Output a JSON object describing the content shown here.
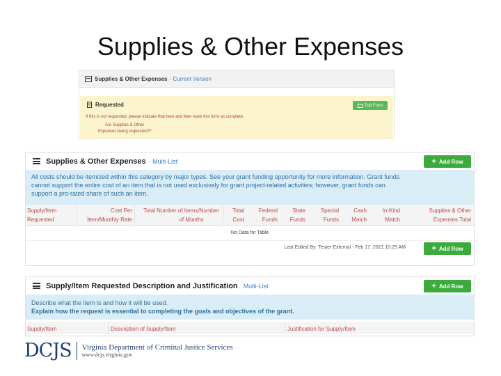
{
  "slide": {
    "title": "Supplies & Other Expenses"
  },
  "panel1": {
    "title": "Supplies & Other Expenses",
    "version": "- Current Version",
    "requested_label": "Requested",
    "edit_button": "Edit Form",
    "note": "If this is not requested, please indicate that here and then mark this form as complete.",
    "question_line1": "Are Supplies & Other",
    "question_line2": "Expenses being requested?*"
  },
  "panel2": {
    "title": "Supplies & Other Expenses",
    "subtitle": "- Multi-List",
    "add_row_top": "Add Row",
    "info_lines": [
      "All costs should be itemized within this category by major types. See your grant funding opportunity for more information. Grant funds",
      "cannot support the entire cost of an item that is not used exclusively for grant project-related activities; however, grant funds can",
      "support a pro-rated share of such an item."
    ],
    "columns": [
      {
        "l1": "Supply/Item",
        "l2": "Requested"
      },
      {
        "l1": "Cost Per",
        "l2": "Item/Monthly Rate"
      },
      {
        "l1": "Total Number of Items/Number",
        "l2": "of Months"
      },
      {
        "l1": "Total",
        "l2": "Cost"
      },
      {
        "l1": "Federal",
        "l2": "Funds"
      },
      {
        "l1": "State",
        "l2": "Funds"
      },
      {
        "l1": "Special",
        "l2": "Funds"
      },
      {
        "l1": "Cash",
        "l2": "Match"
      },
      {
        "l1": "In-Kind",
        "l2": "Match"
      },
      {
        "l1": "Supplies & Other",
        "l2": "Expenses Total"
      }
    ],
    "no_data": "No Data for Table",
    "last_edited": "Last Edited By: Tester External - Feb 17, 2021 10:25 AM",
    "add_row_bottom": "Add Row"
  },
  "panel3": {
    "title": "Supply/Item Requested Description and Justification",
    "subtitle": "Multi-List",
    "add_row": "Add Row",
    "info_line1": "Describe what the item is and how it will be used.",
    "info_line2": "Explain how the request is essential to completing the goals and objectives of the grant.",
    "columns": [
      "Supply/Item",
      "Description of Supply/Item",
      "Justification for Supply/Item"
    ]
  },
  "logo": {
    "abbr": "DCJS",
    "department": "Virginia Department of Criminal Justice Services",
    "url": "www.dcjs.virginia.gov"
  },
  "colors": {
    "green": "#3cab3c",
    "info_bg": "#d9edf7",
    "header_text": "#b94a48",
    "warning_bg": "#fcf4cc",
    "logo_blue": "#1f3f78"
  }
}
